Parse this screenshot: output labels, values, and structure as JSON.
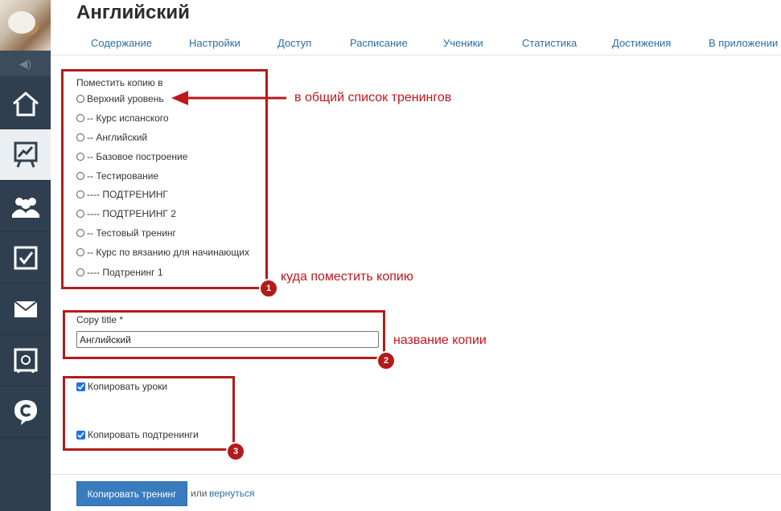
{
  "page": {
    "title": "Английский"
  },
  "tabs": [
    "Содержание",
    "Настройки",
    "Доступ",
    "Расписание",
    "Ученики",
    "Статистика",
    "Достижения",
    "В приложении"
  ],
  "sidebar": {
    "items": [
      {
        "icon": "home-icon"
      },
      {
        "icon": "trainings-chart-icon",
        "active": true
      },
      {
        "icon": "users-icon"
      },
      {
        "icon": "tasks-checkbox-icon"
      },
      {
        "icon": "mail-icon"
      },
      {
        "icon": "safe-icon"
      },
      {
        "icon": "chat-c-icon"
      }
    ]
  },
  "form": {
    "place_label": "Поместить копию в",
    "options": [
      "Верхний уровень",
      "-- Курс испанского",
      "-- Английский",
      "-- Базовое построение",
      "-- Тестирование",
      "---- ПОДТРЕНИНГ",
      "---- ПОДТРЕНИНГ 2",
      "-- Тестовый тренинг",
      "-- Курс по вязанию для начинающих",
      "---- Подтренинг 1"
    ],
    "copy_title_label": "Copy title *",
    "copy_title_value": "Английский",
    "copy_lessons_label": "Копировать уроки",
    "copy_lessons_checked": true,
    "copy_subtrainings_label": "Копировать подтренинги",
    "copy_subtrainings_checked": true,
    "submit_label": "Копировать тренинг",
    "or_text": "или",
    "back_label": "вернуться"
  },
  "annotations": {
    "arrow_text": "в общий список тренингов",
    "box1_text": "куда поместить копию",
    "box2_text": "название копии",
    "badges": [
      "1",
      "2",
      "3"
    ],
    "color": "#b31b1b"
  }
}
